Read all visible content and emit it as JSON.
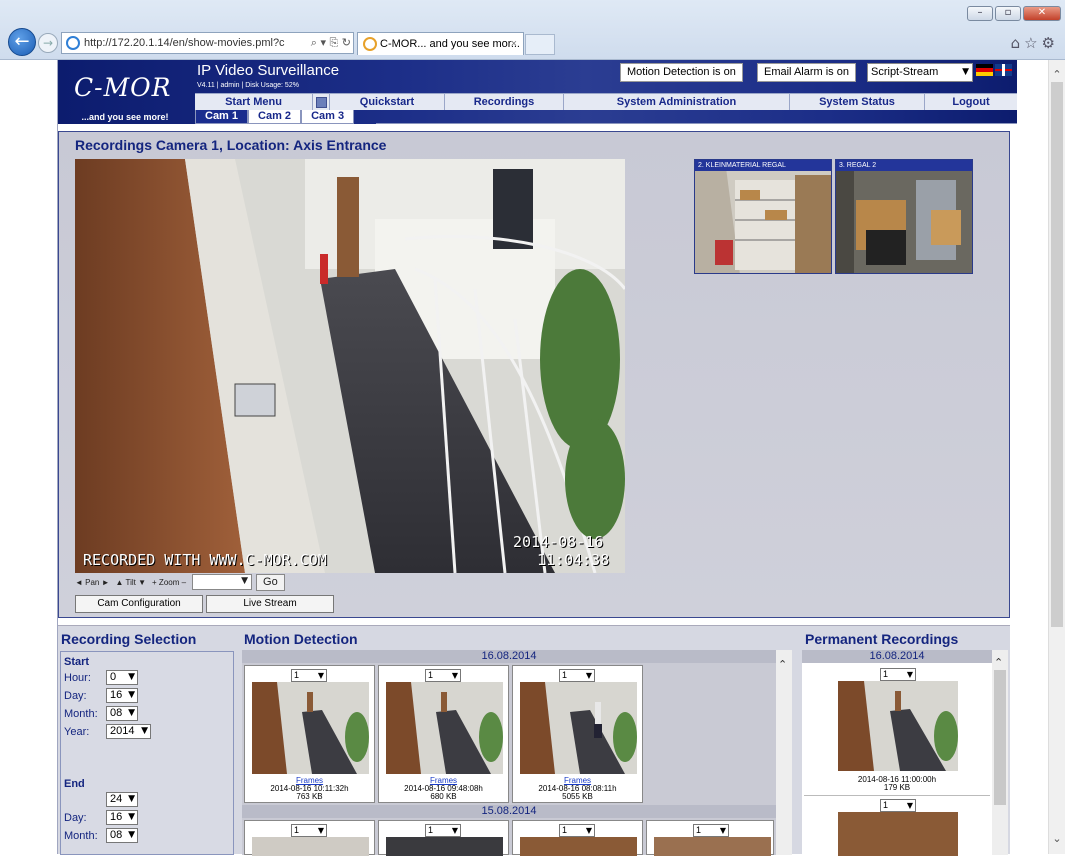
{
  "browser": {
    "url": "http://172.20.1.14/en/show-movies.pml?c",
    "tab_title": "C-MOR... and you see mor...",
    "tab_close": "×",
    "addr_tools": "⌕ ▾ ⎘ ↻",
    "win_min": "–",
    "win_max": "▫",
    "win_close": "✕",
    "back": "←",
    "forward": "→",
    "toolbar_icons": "⌂☆⚙",
    "icons": [
      "back-icon",
      "forward-icon",
      "home-icon",
      "favorites-icon",
      "settings-icon"
    ]
  },
  "header": {
    "logo": "C-MOR",
    "tagline": "...and you see more!",
    "title": "IP Video Surveillance",
    "info": "V4.11 | admin | Disk Usage: 52%",
    "motion_btn": "Motion Detection is on",
    "email_btn": "Email Alarm is on",
    "stream_select": "Script-Stream",
    "nav": [
      "Start Menu",
      "Quickstart",
      "Recordings",
      "System Administration",
      "System Status",
      "Logout"
    ],
    "cam_tabs": [
      "Cam 1",
      "Cam 2",
      "Cam 3"
    ],
    "active_cam": "Cam 1"
  },
  "recordings": {
    "title": "Recordings Camera 1, Location: Axis Entrance",
    "overlay_left": "RECORDED WITH WWW.C-MOR.COM",
    "overlay_date": "2014-08-16",
    "overlay_time": "11:04:38",
    "ptz": {
      "pan": "◄ Pan ►",
      "tilt": "▲ Tilt ▼",
      "zoom": "+ Zoom –",
      "go": "Go"
    },
    "cam_config_btn": "Cam Configuration",
    "live_stream_btn": "Live Stream",
    "thumbs": [
      {
        "caption": "2. KLEINMATERIAL REGAL"
      },
      {
        "caption": "3. REGAL 2"
      }
    ]
  },
  "selection": {
    "title": "Recording Selection",
    "start_label": "Start",
    "hour_label": "Hour:",
    "hour_value": "0",
    "day_label": "Day:",
    "day_value": "16",
    "month_label": "Month:",
    "month_value": "08",
    "year_label": "Year:",
    "year_value": "2014",
    "end_label": "End",
    "end_hour_value": "24",
    "end_day_value": "16",
    "end_month_value": "08"
  },
  "motion": {
    "title": "Motion Detection",
    "date1": "16.08.2014",
    "date2": "15.08.2014",
    "cards": [
      {
        "sel": "1",
        "link": "Frames",
        "ts": "2014-08-16 10:11:32h",
        "size": "763 KB"
      },
      {
        "sel": "1",
        "link": "Frames",
        "ts": "2014-08-16 09:48:08h",
        "size": "680 KB"
      },
      {
        "sel": "1",
        "link": "Frames",
        "ts": "2014-08-16 08:08:11h",
        "size": "5055 KB"
      }
    ],
    "row2_sel": [
      "1",
      "1",
      "1",
      "1"
    ]
  },
  "permanent": {
    "title": "Permanent Recordings",
    "date": "16.08.2014",
    "sel": "1",
    "ts": "2014-08-16 11:00:00h",
    "size": "179 KB",
    "sel2": "1"
  },
  "colors": {
    "header_bg": "#0c1c6e",
    "nav_text": "#18288a",
    "title_text": "#14257f",
    "panel_bg": "#c8c9d5"
  }
}
